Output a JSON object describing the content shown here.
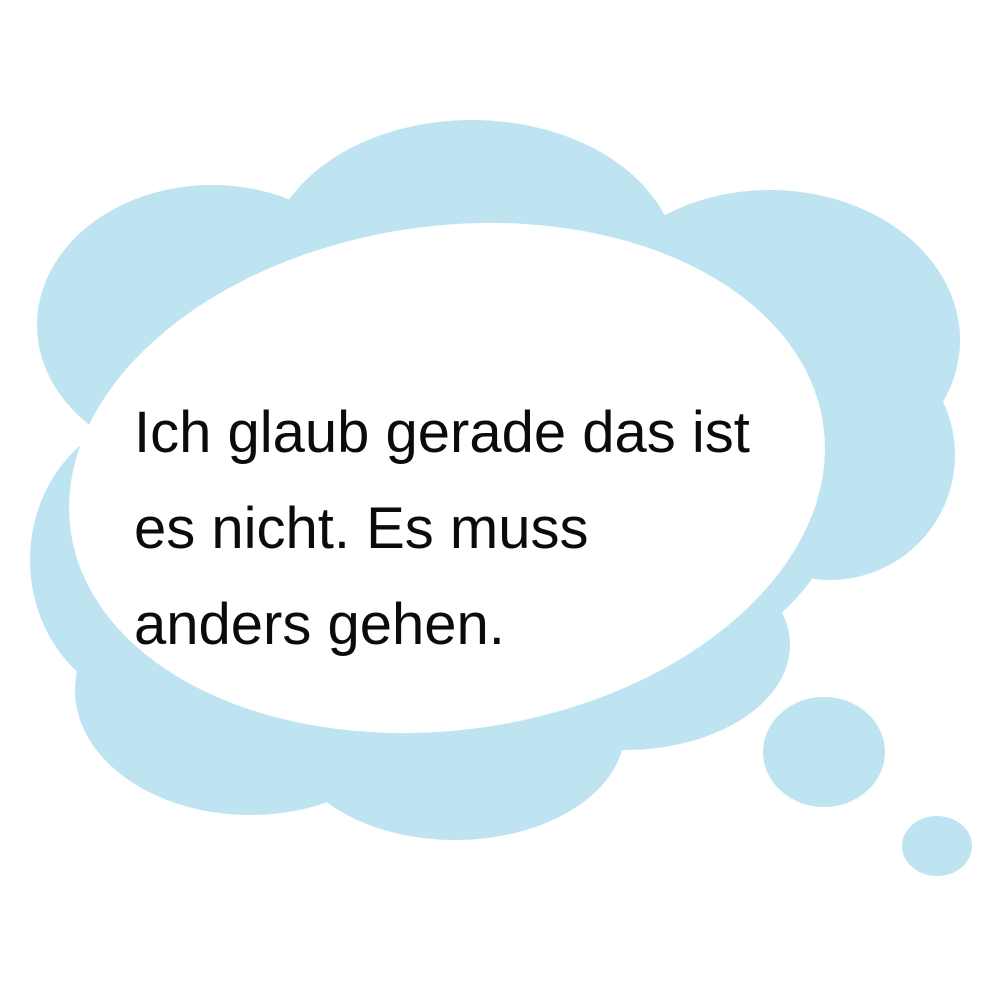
{
  "bubble": {
    "fill_color": "#bee4f1",
    "inner_color": "#ffffff",
    "text_color": "#0b0b0b",
    "lines": [
      "Ich glaub gerade das ist",
      "es nicht. Es muss",
      "anders gehen."
    ]
  }
}
